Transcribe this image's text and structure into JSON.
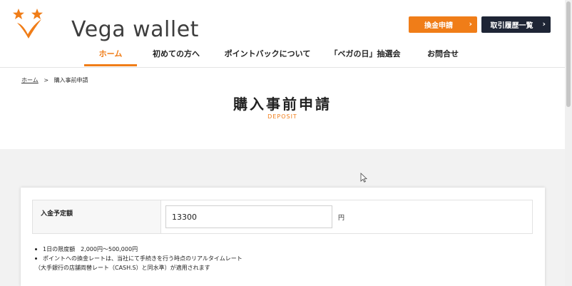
{
  "header": {
    "logo_text": "Vega wallet",
    "exchange_button": "換金申請",
    "history_button": "取引履歴一覧",
    "chevron": "›"
  },
  "nav": {
    "items": [
      {
        "label": "ホーム",
        "active": true
      },
      {
        "label": "初めての方へ",
        "active": false
      },
      {
        "label": "ポイントバックについて",
        "active": false
      },
      {
        "label": "「ベガの日」抽選会",
        "active": false
      },
      {
        "label": "お問合せ",
        "active": false
      }
    ]
  },
  "breadcrumb": {
    "home": "ホーム",
    "separator": ">",
    "current": "購入事前申請"
  },
  "page": {
    "title": "購入事前申請",
    "subtitle": "DEPOSIT"
  },
  "form": {
    "label": "入金予定額",
    "amount_value": "13300",
    "unit": "円"
  },
  "notes": {
    "line1": "1日の限度額　2,000円〜500,000円",
    "line2": "ポイントへの換金レートは、当社にて手続きを行う時点のリアルタイムレート",
    "line3": "（大手銀行の店舗両替レート（CASH.S）と同水準）が適用されます"
  },
  "colors": {
    "accent": "#f07d18",
    "dark_button": "#1e2535",
    "background_gray": "#f2f2f2"
  }
}
